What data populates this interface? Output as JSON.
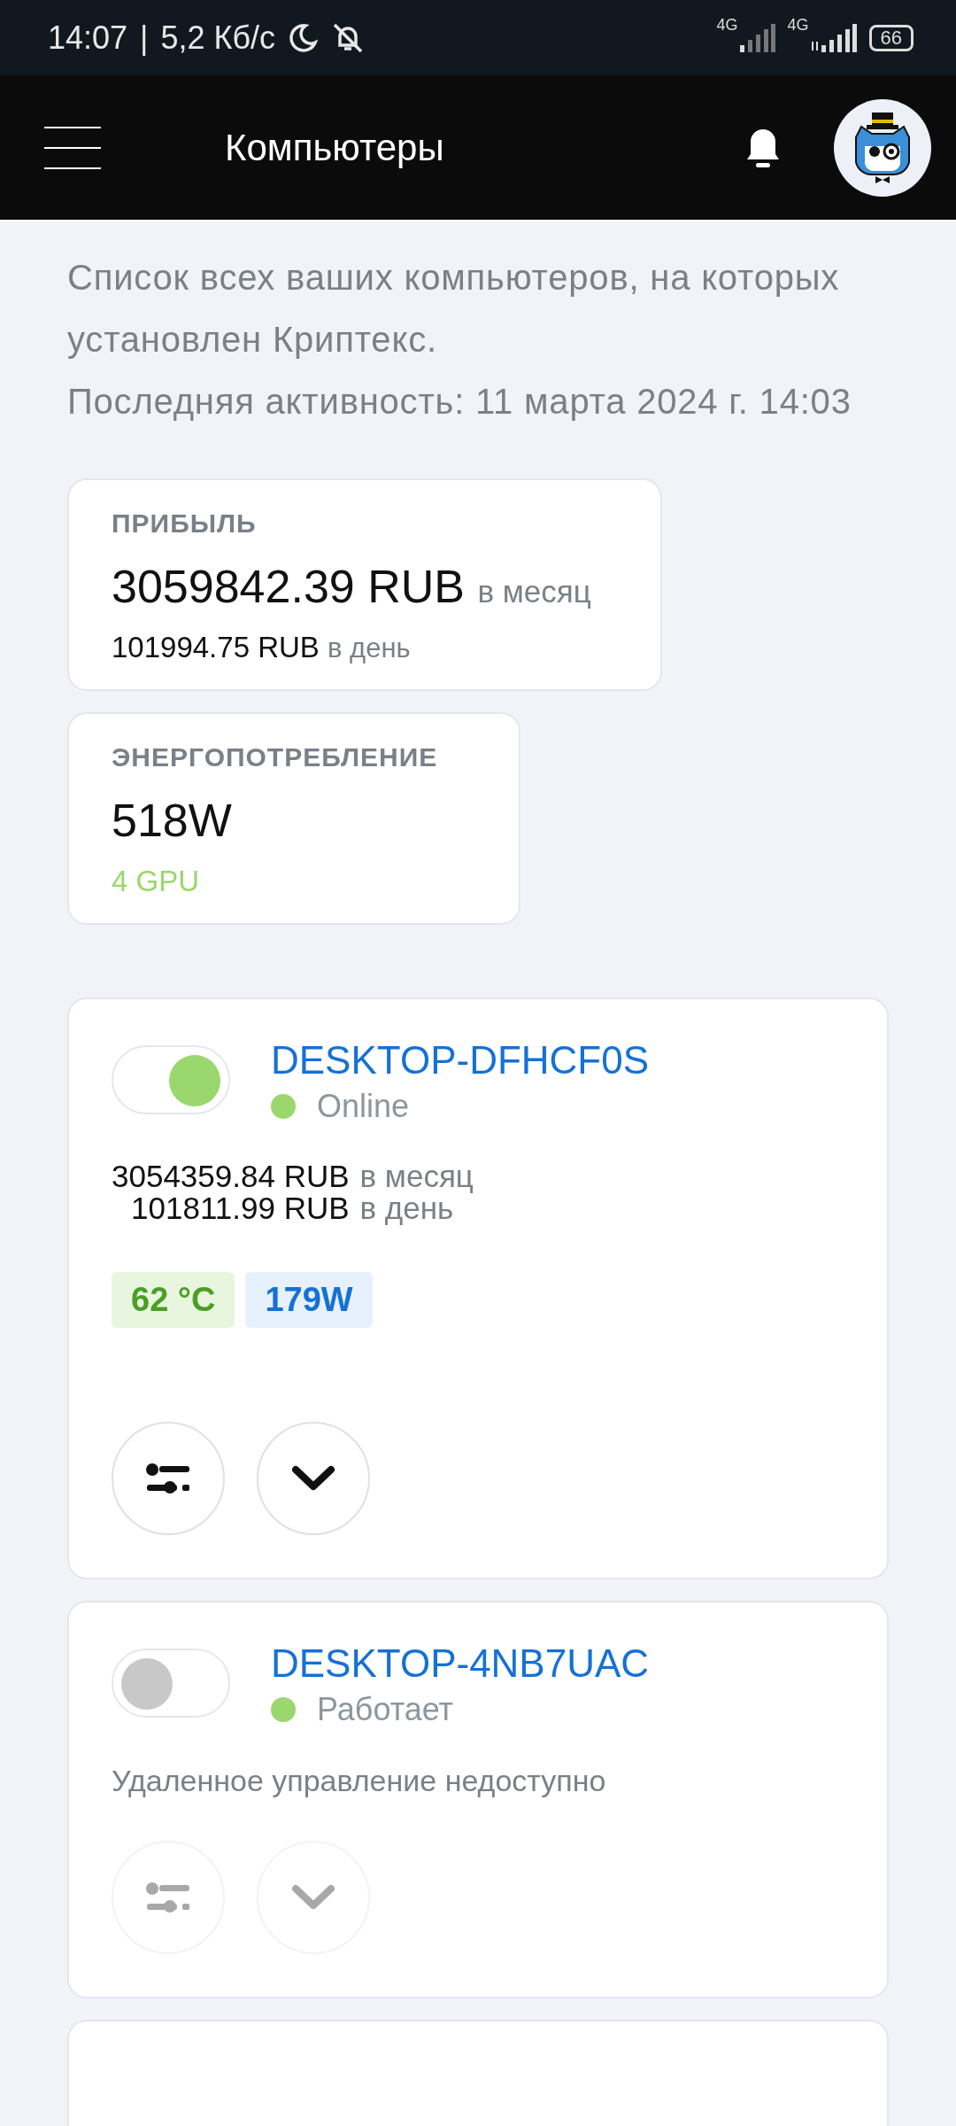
{
  "status_bar": {
    "time": "14:07",
    "separator": "|",
    "speed": "5,2 Кб/с",
    "network_1": "4G",
    "network_2": "4G",
    "battery": "66"
  },
  "header": {
    "title": "Компьютеры"
  },
  "intro": {
    "lines": [
      "Список всех ваших компьютеров, на которых установлен Криптекс.",
      "Последняя активность: 11 марта 2024 г. 14:03"
    ]
  },
  "stats": [
    {
      "label": "ПРИБЫЛЬ",
      "value": "3059842.39 RUB",
      "value_unit": "в месяц",
      "sub": "101994.75 RUB",
      "sub_unit": "в день",
      "kind": "profit"
    },
    {
      "label": "ЭНЕРГОПОТРЕБЛЕНИЕ",
      "value": "518W",
      "sub": "4 GPU",
      "kind": "power"
    }
  ],
  "computers": [
    {
      "name": "DESKTOP-DFHCF0S",
      "on": true,
      "status": "Online",
      "color": "#9ad76d",
      "monthly": "3054359.84 RUB",
      "monthly_unit": "в месяц",
      "daily": "101811.99 RUB",
      "daily_unit": "в день",
      "temperature": "62 °C",
      "power": "179W",
      "disabled": false
    },
    {
      "name": "DESKTOP-4NB7UAC",
      "on": false,
      "status": "Работает",
      "color": "#9ad76d",
      "note": "Удаленное управление недоступно",
      "disabled": true
    }
  ]
}
